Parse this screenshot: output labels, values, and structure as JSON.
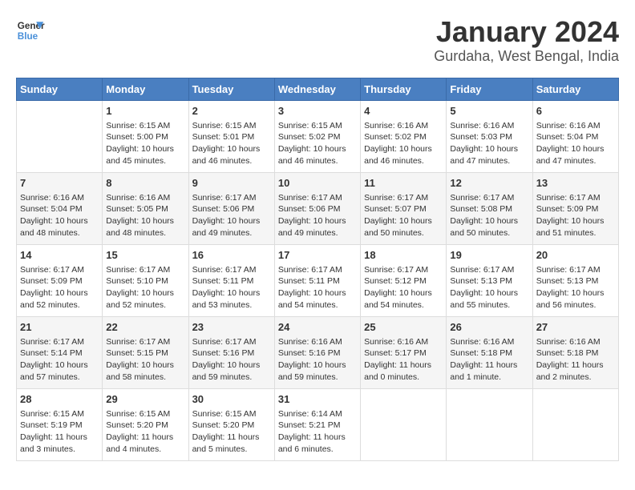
{
  "header": {
    "logo_line1": "General",
    "logo_line2": "Blue",
    "title": "January 2024",
    "subtitle": "Gurdaha, West Bengal, India"
  },
  "days_of_week": [
    "Sunday",
    "Monday",
    "Tuesday",
    "Wednesday",
    "Thursday",
    "Friday",
    "Saturday"
  ],
  "weeks": [
    [
      {
        "day": "",
        "info": ""
      },
      {
        "day": "1",
        "info": "Sunrise: 6:15 AM\nSunset: 5:00 PM\nDaylight: 10 hours\nand 45 minutes."
      },
      {
        "day": "2",
        "info": "Sunrise: 6:15 AM\nSunset: 5:01 PM\nDaylight: 10 hours\nand 46 minutes."
      },
      {
        "day": "3",
        "info": "Sunrise: 6:15 AM\nSunset: 5:02 PM\nDaylight: 10 hours\nand 46 minutes."
      },
      {
        "day": "4",
        "info": "Sunrise: 6:16 AM\nSunset: 5:02 PM\nDaylight: 10 hours\nand 46 minutes."
      },
      {
        "day": "5",
        "info": "Sunrise: 6:16 AM\nSunset: 5:03 PM\nDaylight: 10 hours\nand 47 minutes."
      },
      {
        "day": "6",
        "info": "Sunrise: 6:16 AM\nSunset: 5:04 PM\nDaylight: 10 hours\nand 47 minutes."
      }
    ],
    [
      {
        "day": "7",
        "info": "Sunrise: 6:16 AM\nSunset: 5:04 PM\nDaylight: 10 hours\nand 48 minutes."
      },
      {
        "day": "8",
        "info": "Sunrise: 6:16 AM\nSunset: 5:05 PM\nDaylight: 10 hours\nand 48 minutes."
      },
      {
        "day": "9",
        "info": "Sunrise: 6:17 AM\nSunset: 5:06 PM\nDaylight: 10 hours\nand 49 minutes."
      },
      {
        "day": "10",
        "info": "Sunrise: 6:17 AM\nSunset: 5:06 PM\nDaylight: 10 hours\nand 49 minutes."
      },
      {
        "day": "11",
        "info": "Sunrise: 6:17 AM\nSunset: 5:07 PM\nDaylight: 10 hours\nand 50 minutes."
      },
      {
        "day": "12",
        "info": "Sunrise: 6:17 AM\nSunset: 5:08 PM\nDaylight: 10 hours\nand 50 minutes."
      },
      {
        "day": "13",
        "info": "Sunrise: 6:17 AM\nSunset: 5:09 PM\nDaylight: 10 hours\nand 51 minutes."
      }
    ],
    [
      {
        "day": "14",
        "info": "Sunrise: 6:17 AM\nSunset: 5:09 PM\nDaylight: 10 hours\nand 52 minutes."
      },
      {
        "day": "15",
        "info": "Sunrise: 6:17 AM\nSunset: 5:10 PM\nDaylight: 10 hours\nand 52 minutes."
      },
      {
        "day": "16",
        "info": "Sunrise: 6:17 AM\nSunset: 5:11 PM\nDaylight: 10 hours\nand 53 minutes."
      },
      {
        "day": "17",
        "info": "Sunrise: 6:17 AM\nSunset: 5:11 PM\nDaylight: 10 hours\nand 54 minutes."
      },
      {
        "day": "18",
        "info": "Sunrise: 6:17 AM\nSunset: 5:12 PM\nDaylight: 10 hours\nand 54 minutes."
      },
      {
        "day": "19",
        "info": "Sunrise: 6:17 AM\nSunset: 5:13 PM\nDaylight: 10 hours\nand 55 minutes."
      },
      {
        "day": "20",
        "info": "Sunrise: 6:17 AM\nSunset: 5:13 PM\nDaylight: 10 hours\nand 56 minutes."
      }
    ],
    [
      {
        "day": "21",
        "info": "Sunrise: 6:17 AM\nSunset: 5:14 PM\nDaylight: 10 hours\nand 57 minutes."
      },
      {
        "day": "22",
        "info": "Sunrise: 6:17 AM\nSunset: 5:15 PM\nDaylight: 10 hours\nand 58 minutes."
      },
      {
        "day": "23",
        "info": "Sunrise: 6:17 AM\nSunset: 5:16 PM\nDaylight: 10 hours\nand 59 minutes."
      },
      {
        "day": "24",
        "info": "Sunrise: 6:16 AM\nSunset: 5:16 PM\nDaylight: 10 hours\nand 59 minutes."
      },
      {
        "day": "25",
        "info": "Sunrise: 6:16 AM\nSunset: 5:17 PM\nDaylight: 11 hours\nand 0 minutes."
      },
      {
        "day": "26",
        "info": "Sunrise: 6:16 AM\nSunset: 5:18 PM\nDaylight: 11 hours\nand 1 minute."
      },
      {
        "day": "27",
        "info": "Sunrise: 6:16 AM\nSunset: 5:18 PM\nDaylight: 11 hours\nand 2 minutes."
      }
    ],
    [
      {
        "day": "28",
        "info": "Sunrise: 6:15 AM\nSunset: 5:19 PM\nDaylight: 11 hours\nand 3 minutes."
      },
      {
        "day": "29",
        "info": "Sunrise: 6:15 AM\nSunset: 5:20 PM\nDaylight: 11 hours\nand 4 minutes."
      },
      {
        "day": "30",
        "info": "Sunrise: 6:15 AM\nSunset: 5:20 PM\nDaylight: 11 hours\nand 5 minutes."
      },
      {
        "day": "31",
        "info": "Sunrise: 6:14 AM\nSunset: 5:21 PM\nDaylight: 11 hours\nand 6 minutes."
      },
      {
        "day": "",
        "info": ""
      },
      {
        "day": "",
        "info": ""
      },
      {
        "day": "",
        "info": ""
      }
    ]
  ]
}
